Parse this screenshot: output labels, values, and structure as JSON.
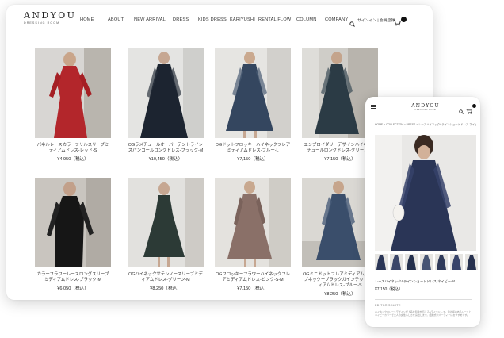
{
  "brand": {
    "name": "ANDYOU",
    "tagline": "DRESSING ROOM"
  },
  "nav": [
    "HOME",
    "ABOUT",
    "NEW ARRIVAL",
    "DRESS",
    "KIDS DRESS",
    "KARIYUSHI",
    "RENTAL FLOW",
    "COLUMN",
    "COMPANY"
  ],
  "header_utils": {
    "signin": "サインイン | 会員登録",
    "search_icon": "search-icon",
    "cart_icon": "cart-icon"
  },
  "products": [
    {
      "name": "パネルレースカラーフリルスリーブミディアムドレス-レッド-S",
      "price": "¥4,950（税込）",
      "color": "#b3262b"
    },
    {
      "name": "OGラメチュールオーバーテントラインスパンコールロングドレス-ブラック-M",
      "price": "¥10,450（税込）",
      "color": "#1c2430"
    },
    {
      "name": "OGドットフロッキーハイネックフレアミディアムドレス-ブルー-L",
      "price": "¥7,150（税込）",
      "color": "#34465f"
    },
    {
      "name": "エンブロイダリーデザインハイネックチュールロングドレス-グリーン-M",
      "price": "¥7,150（税込）",
      "color": "#2b3b45"
    },
    {
      "name": "カラーフラワーレースロングスリーブミディアムドレス-ブラック-M",
      "price": "¥6,050（税込）",
      "color": "#161616"
    },
    {
      "name": "OGハイネックサテンノースリーブミディアムドレス-グリーン-M",
      "price": "¥8,250（税込）",
      "color": "#2c3a36"
    },
    {
      "name": "OGフロッキーフラワーハイネックフレアミディアムドレス-ピンク-S-M",
      "price": "¥7,150（税込）",
      "color": "#8a7068"
    },
    {
      "name": "OGミニドットフレアミディアムスリーブネックーブラックガインチットミディアムドレス-ブルー-S",
      "price": "¥8,250（税込）",
      "color": "#3a4e6b"
    }
  ],
  "mobile": {
    "breadcrumb": "HOME > COLLECTION > DRESS > レースハイネックAラインショートドレス-ネイビー-M",
    "product_name": "レースハイネックAラインショートドレス-ネイビー-M",
    "price": "¥7,150（税込）",
    "note_title": "EDITOR'S NOTE",
    "note": "ハイネックのレースデザインが上品な印象を与えるAラインドレス。透け感のあるレースとネイビーカラーで大人の女性らしさを演出します。結婚式やパーティーにおすすめです。",
    "hero_color": "#2a3556",
    "thumb_colors": [
      "#2a3556",
      "#3b4668",
      "#24304d",
      "#465474",
      "#2f3a5a",
      "#38446a",
      "#27314f"
    ]
  },
  "colors": {
    "accent": "#111111",
    "text": "#222222"
  }
}
